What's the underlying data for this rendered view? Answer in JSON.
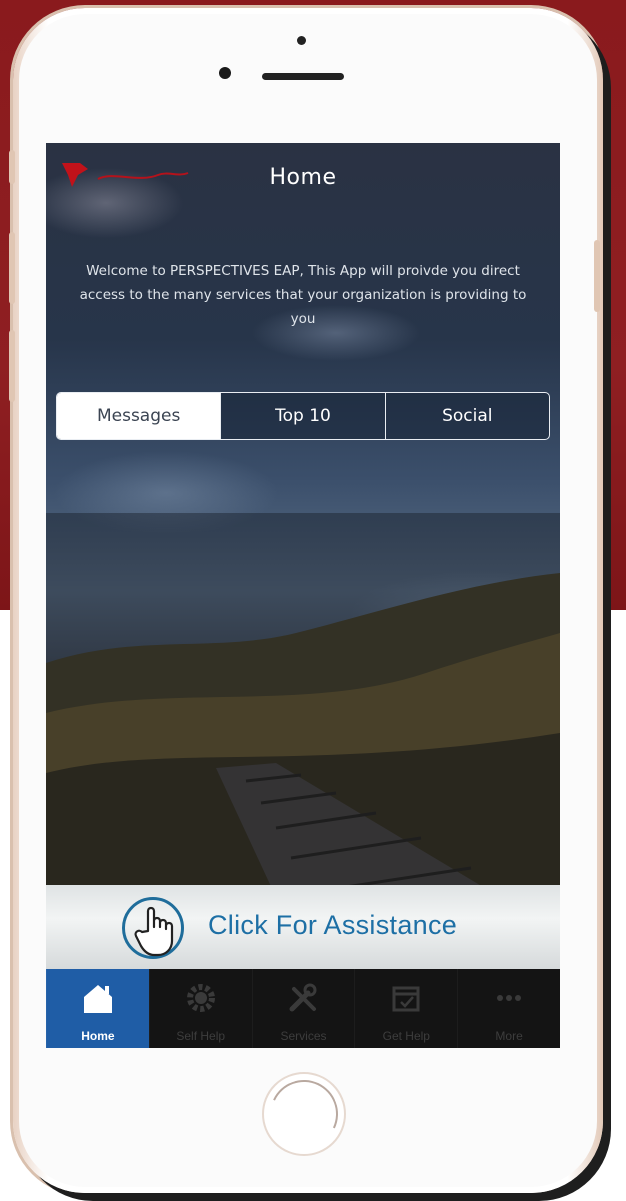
{
  "header": {
    "title": "Home",
    "logo_icon": "perspectives-logo-icon"
  },
  "welcome_text": "Welcome to PERSPECTIVES EAP, This App will proivde you direct access to the many services that your organization is providing to you",
  "segments": {
    "items": [
      {
        "label": "Messages",
        "active": true
      },
      {
        "label": "Top 10",
        "active": false
      },
      {
        "label": "Social",
        "active": false
      }
    ]
  },
  "assistance": {
    "label": "Click For Assistance",
    "icon": "hand-pointer-icon"
  },
  "tabbar": {
    "items": [
      {
        "label": "Home",
        "icon": "house-icon",
        "active": true
      },
      {
        "label": "Self Help",
        "icon": "gear-icon",
        "active": false
      },
      {
        "label": "Services",
        "icon": "tools-icon",
        "active": false
      },
      {
        "label": "Get Help",
        "icon": "calendar-icon",
        "active": false
      },
      {
        "label": "More",
        "icon": "more-dots-icon",
        "active": false
      }
    ]
  },
  "colors": {
    "background_top": "#8a1a1d",
    "active_tab": "#1f5da6",
    "assistance_text": "#1d6fa5"
  }
}
